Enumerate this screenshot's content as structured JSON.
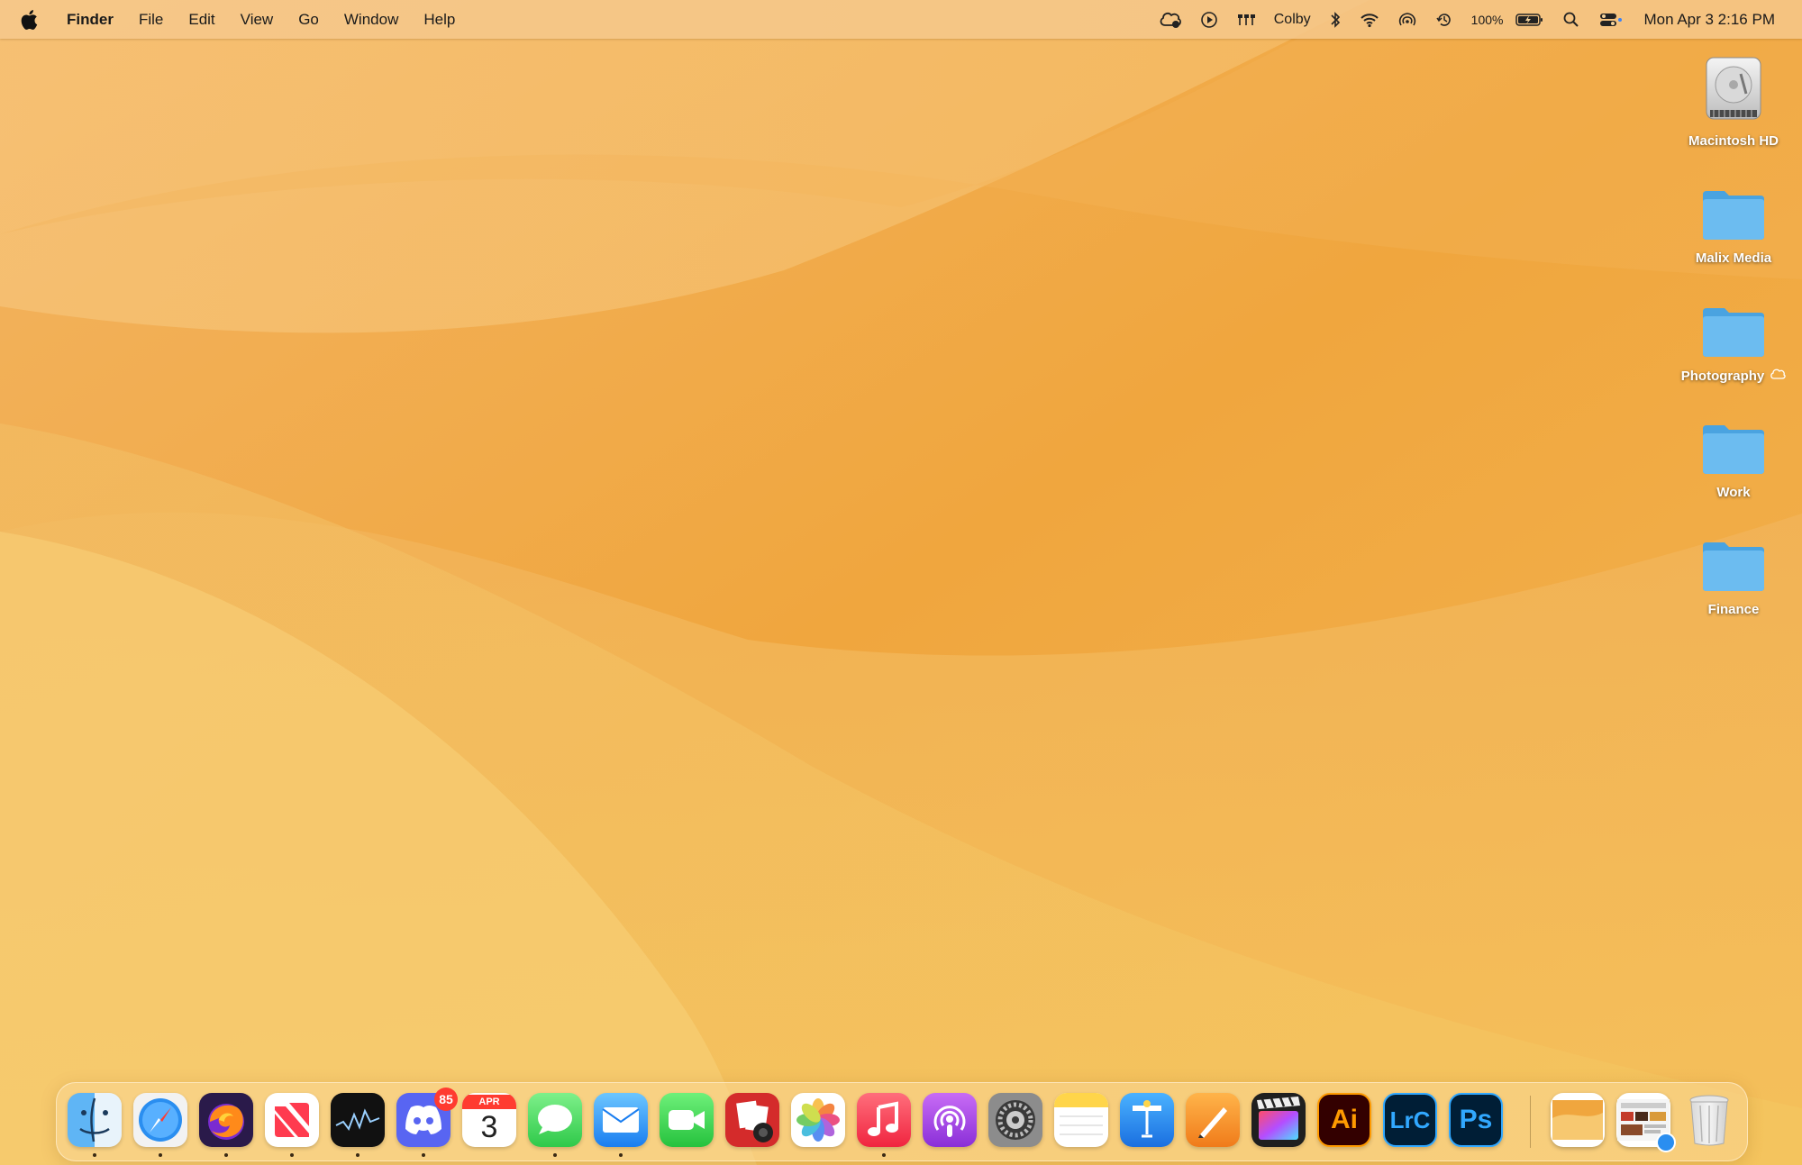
{
  "menubar": {
    "app_name": "Finder",
    "menus": [
      "File",
      "Edit",
      "View",
      "Go",
      "Window",
      "Help"
    ],
    "status": {
      "user_name": "Colby",
      "battery_percent": "100%",
      "datetime": "Mon Apr 3  2:16 PM"
    },
    "status_icons": [
      "creative-cloud-icon",
      "play-icon",
      "network-activity-icon",
      "bluetooth-icon",
      "wifi-icon",
      "airdrop-icon",
      "time-machine-icon",
      "battery-charging-icon",
      "spotlight-icon",
      "control-center-icon"
    ]
  },
  "desktop": {
    "items": [
      {
        "label": "Macintosh HD",
        "icon": "hard-drive-icon"
      },
      {
        "label": "Malix Media",
        "icon": "folder-icon"
      },
      {
        "label": "Photography",
        "icon": "folder-icon",
        "cloud": true
      },
      {
        "label": "Work",
        "icon": "folder-icon"
      },
      {
        "label": "Finance",
        "icon": "folder-icon"
      }
    ]
  },
  "dock": {
    "apps": [
      {
        "name": "Finder",
        "icon": "finder-icon",
        "running": true
      },
      {
        "name": "Safari",
        "icon": "safari-icon",
        "running": true
      },
      {
        "name": "Firefox",
        "icon": "firefox-icon",
        "running": true
      },
      {
        "name": "News",
        "icon": "news-icon",
        "running": true
      },
      {
        "name": "Stocks",
        "icon": "stocks-icon",
        "running": true
      },
      {
        "name": "Discord",
        "icon": "discord-icon",
        "running": true,
        "badge": "85"
      },
      {
        "name": "Calendar",
        "icon": "calendar-icon",
        "running": false,
        "month": "APR",
        "day": "3"
      },
      {
        "name": "Messages",
        "icon": "messages-icon",
        "running": true
      },
      {
        "name": "Mail",
        "icon": "mail-icon",
        "running": true
      },
      {
        "name": "FaceTime",
        "icon": "facetime-icon",
        "running": false
      },
      {
        "name": "Photo Booth",
        "icon": "photo-booth-icon",
        "running": false
      },
      {
        "name": "Photos",
        "icon": "photos-icon",
        "running": false
      },
      {
        "name": "Music",
        "icon": "music-icon",
        "running": true
      },
      {
        "name": "Podcasts",
        "icon": "podcasts-icon",
        "running": false
      },
      {
        "name": "System Settings",
        "icon": "settings-icon",
        "running": false
      },
      {
        "name": "Notes",
        "icon": "notes-icon",
        "running": false
      },
      {
        "name": "Keynote",
        "icon": "keynote-icon",
        "running": false
      },
      {
        "name": "Pages",
        "icon": "pages-icon",
        "running": false
      },
      {
        "name": "Final Cut Pro",
        "icon": "final-cut-icon",
        "running": false
      },
      {
        "name": "Adobe Illustrator",
        "icon": "illustrator-icon",
        "running": false,
        "text": "Ai"
      },
      {
        "name": "Lightroom Classic",
        "icon": "lightroom-icon",
        "running": false,
        "text": "LrC"
      },
      {
        "name": "Adobe Photoshop",
        "icon": "photoshop-icon",
        "running": false,
        "text": "Ps"
      }
    ],
    "stacks": [
      {
        "name": "Wallpaper Stack",
        "icon": "wallpaper-stack-icon"
      },
      {
        "name": "Downloads Stack",
        "icon": "downloads-stack-icon"
      },
      {
        "name": "Trash",
        "icon": "trash-icon"
      }
    ]
  },
  "colors": {
    "folder_blue": "#5fb3ea",
    "wallpaper_base": "#f0a63e",
    "badge_red": "#ff3b30"
  }
}
